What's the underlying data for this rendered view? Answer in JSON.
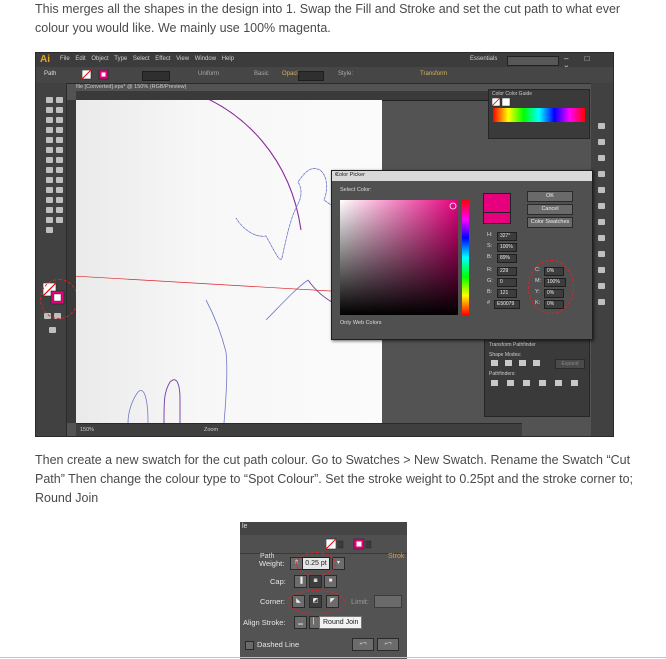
{
  "article": {
    "para1": "This merges all the shapes in the design into 1. Swap the Fill and Stroke and set the cut path to what ever colour you would like. We mainly use 100% magenta.",
    "para2": "Then create a new swatch for the cut path colour. Go to Swatches > New Swatch. Rename the Swatch “Cut Path” Then change the colour type to “Spot Colour”. Set the stroke weight to 0.25pt and the stroke corner to; Round Join"
  },
  "illustrator": {
    "logo": "Ai",
    "menu": "File Edit Object Type Select Effect View Window Help",
    "workspace": "Essentials",
    "window_buttons": "– □ ×",
    "control_bar": {
      "selection": "Path",
      "uniform": "Uniform",
      "basic": "Basic",
      "opacity": "Opacity:",
      "style": "Style:",
      "transform": "Transform"
    },
    "doc_tab": "file [Converted].eps* @ 150% (RGB/Preview)",
    "status": {
      "zoom_value": "150%",
      "zoom_label": "Zoom"
    },
    "color_panel": {
      "tabs": "Color   Color Guide"
    },
    "pathfinder": {
      "tabs": "Transform  Pathfinder",
      "shape_modes": "Shape Modes:",
      "pathfinders": "Pathfinders:",
      "expand": "Expand"
    },
    "color_picker": {
      "title": "Color Picker",
      "select_color": "Select Color:",
      "ok": "OK",
      "cancel": "Cancel",
      "swatches": "Color Swatches",
      "h_label": "H:",
      "h_value": "327°",
      "s_label": "S:",
      "s_value": "100%",
      "b_label": "B:",
      "b_value": "89%",
      "r_label": "R:",
      "r_value": "229",
      "g_label": "G:",
      "g_value": "0",
      "bl_label": "B:",
      "bl_value": "121",
      "hex_label": "#",
      "hex_value": "E50079",
      "c_label": "C:",
      "c_value": "0%",
      "m_label": "M:",
      "m_value": "100%",
      "y_label": "Y:",
      "y_value": "0%",
      "k_label": "K:",
      "k_value": "0%",
      "web_only": "Only Web Colors",
      "color": "#e6007e"
    },
    "cut_color": "#e6007e"
  },
  "stroke_panel": {
    "edge": "le",
    "path": "Path",
    "stroke": "Strok",
    "weight_label": "Weight:",
    "weight_value": "0.25 pt",
    "cap_label": "Cap:",
    "corner_label": "Corner:",
    "limit_label": "Limit:",
    "align_label": "Align Stroke:",
    "tooltip": "Round Join",
    "dashed_label": "Dashed Line"
  }
}
